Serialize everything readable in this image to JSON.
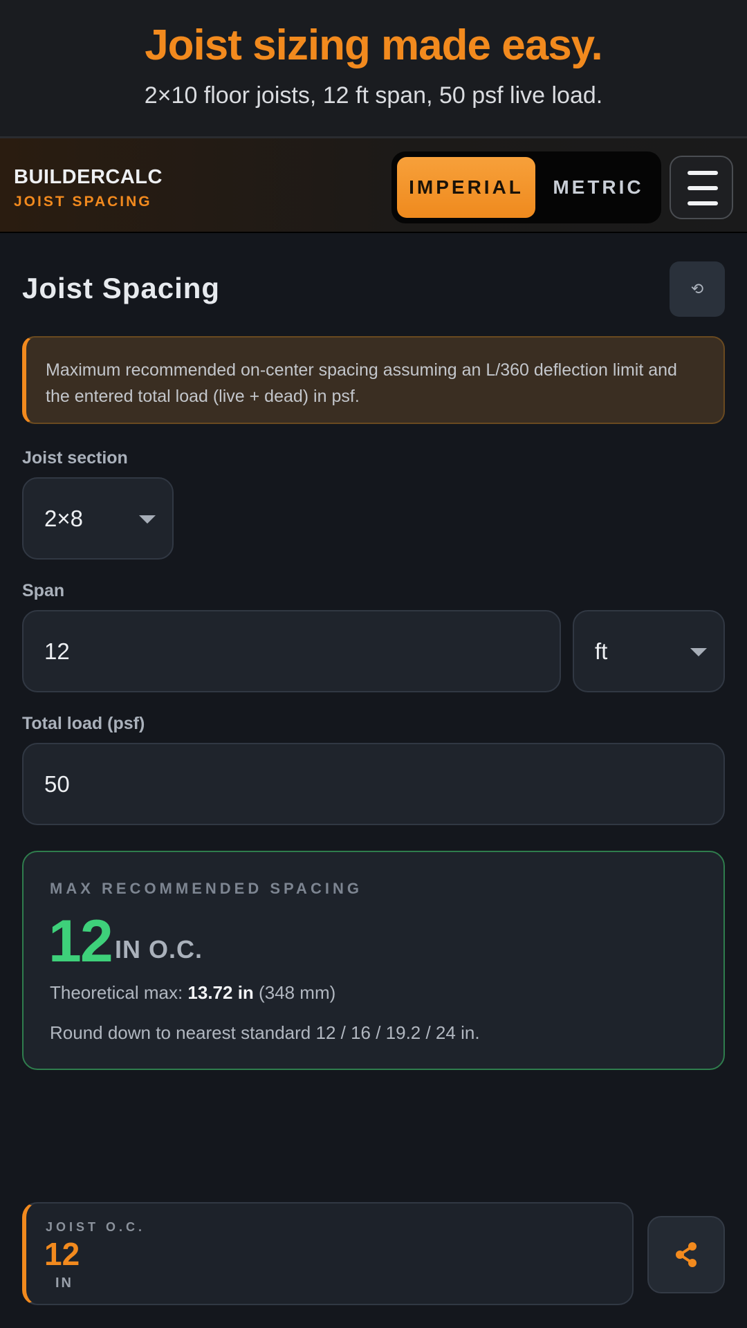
{
  "promo": {
    "title": "Joist sizing made easy.",
    "subtitle": "2×10 floor joists, 12 ft span, 50 psf live load."
  },
  "header": {
    "brand_name": "BUILDERCALC",
    "brand_sub": "JOIST SPACING",
    "units": {
      "imperial": "IMPERIAL",
      "metric": "METRIC",
      "selected": "IMPERIAL"
    },
    "menu_icon": "hamburger-menu-icon"
  },
  "main": {
    "title": "Joist Spacing",
    "reset_icon": "⟲",
    "info": "Maximum recommended on-center spacing assuming an L/360 deflection limit and the entered total load (live + dead) in psf."
  },
  "form": {
    "section_label": "Joist section",
    "section_value": "2×8",
    "span_label": "Span",
    "span_value": "12",
    "span_unit": "ft",
    "load_label": "Total load (psf)",
    "load_value": "50"
  },
  "result": {
    "label": "MAX RECOMMENDED SPACING",
    "value": "12",
    "unit": "IN O.C.",
    "theoretical_prefix": "Theoretical max: ",
    "theoretical_value": "13.72 in",
    "theoretical_metric": " (348 mm)",
    "note": "Round down to nearest standard 12 / 16 / 19.2 / 24 in."
  },
  "footer": {
    "label": "JOIST O.C.",
    "value": "12",
    "unit": "IN",
    "share_icon": "share-icon"
  },
  "colors": {
    "accent": "#f28a1e",
    "success": "#3ed07a",
    "background": "#14171d"
  }
}
